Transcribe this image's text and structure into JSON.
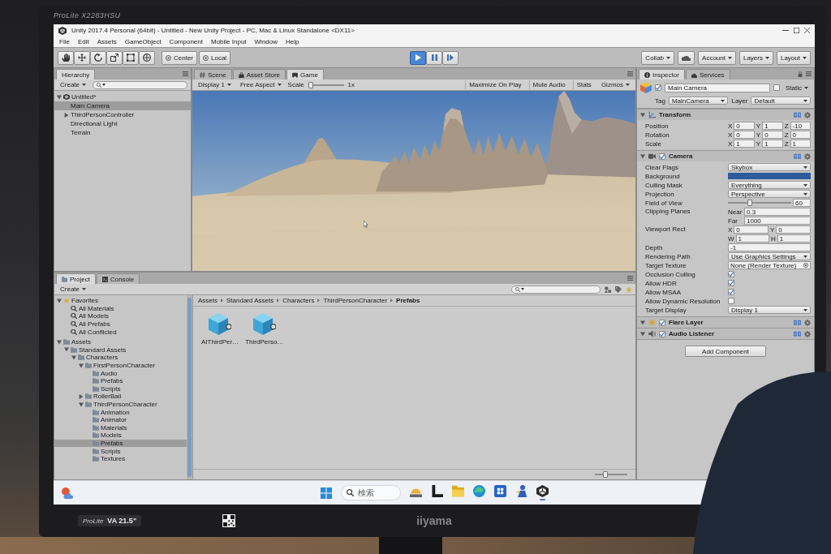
{
  "monitor": {
    "model": "ProLite X2283HSU",
    "brand": "iiyama",
    "sticker": {
      "series": "ProLite",
      "size": "VA 21.5\""
    }
  },
  "title_bar": {
    "title": "Unity 2017.4 Personal (64bit) - Untitled - New Unity Project - PC, Mac & Linux Standalone <DX11>"
  },
  "menu": [
    "File",
    "Edit",
    "Assets",
    "GameObject",
    "Component",
    "Mobile Input",
    "Window",
    "Help"
  ],
  "toolbar": {
    "pivot": "Center",
    "space": "Local",
    "playing": true,
    "collab": "Collab",
    "account": "Account",
    "layers": "Layers",
    "layout": "Layout"
  },
  "hierarchy": {
    "tabs": [
      {
        "label": "Hierarchy",
        "selected": true
      }
    ],
    "create": "Create",
    "items": [
      {
        "label": "Untitled*",
        "kind": "scene",
        "expanded": true,
        "selected": false,
        "children": [
          {
            "label": "Main Camera",
            "selected": true
          },
          {
            "label": "ThirdPersonController",
            "expanded": false,
            "selected": false
          },
          {
            "label": "Directional Light",
            "selected": false
          },
          {
            "label": "Terrain",
            "selected": false
          }
        ]
      }
    ]
  },
  "center": {
    "tabs": [
      {
        "label": "Scene",
        "kind": "scene",
        "selected": false
      },
      {
        "label": "Asset Store",
        "kind": "store",
        "selected": false
      },
      {
        "label": "Game",
        "kind": "game",
        "selected": true
      }
    ],
    "display": "Display 1",
    "aspect": "Free Aspect",
    "scale_label": "Scale",
    "scale": {
      "level": 0
    },
    "scale_value": "1x",
    "toggles": [
      "Maximize On Play",
      "Mute Audio",
      "Stats"
    ],
    "gizmos": "Gizmos"
  },
  "project": {
    "tabs": [
      {
        "label": "Project",
        "kind": "project",
        "selected": true
      },
      {
        "label": "Console",
        "kind": "console",
        "selected": false
      }
    ],
    "create": "Create",
    "tree": [
      {
        "label": "Favorites",
        "kind": "favorites",
        "expanded": true,
        "selected": false,
        "children": [
          {
            "label": "All Materials",
            "kind": "search",
            "selected": false
          },
          {
            "label": "All Models",
            "kind": "search",
            "selected": false
          },
          {
            "label": "All Prefabs",
            "kind": "search",
            "selected": false
          },
          {
            "label": "All Conflicted",
            "kind": "search",
            "selected": false
          }
        ]
      },
      {
        "label": "Assets",
        "kind": "folder",
        "expanded": true,
        "selected": false,
        "children": [
          {
            "label": "Standard Assets",
            "kind": "folder",
            "expanded": true,
            "selected": false,
            "children": [
              {
                "label": "Characters",
                "kind": "folder",
                "expanded": true,
                "selected": false,
                "children": [
                  {
                    "label": "FirstPersonCharacter",
                    "kind": "folder",
                    "expanded": true,
                    "selected": false,
                    "children": [
                      {
                        "label": "Audio",
                        "kind": "folder",
                        "selected": false
                      },
                      {
                        "label": "Prefabs",
                        "kind": "folder",
                        "selected": false
                      },
                      {
                        "label": "Scripts",
                        "kind": "folder",
                        "selected": false
                      }
                    ]
                  },
                  {
                    "label": "RollerBall",
                    "kind": "folder",
                    "expanded": false,
                    "selected": false
                  },
                  {
                    "label": "ThirdPersonCharacter",
                    "kind": "folder",
                    "expanded": true,
                    "selected": false,
                    "children": [
                      {
                        "label": "Animation",
                        "kind": "folder",
                        "selected": false
                      },
                      {
                        "label": "Animator",
                        "kind": "folder",
                        "selected": false
                      },
                      {
                        "label": "Materials",
                        "kind": "folder",
                        "selected": false
                      },
                      {
                        "label": "Models",
                        "kind": "folder",
                        "selected": false
                      },
                      {
                        "label": "Prefabs",
                        "kind": "folder",
                        "selected": true
                      },
                      {
                        "label": "Scripts",
                        "kind": "folder",
                        "selected": false
                      },
                      {
                        "label": "Textures",
                        "kind": "folder",
                        "selected": false
                      }
                    ]
                  }
                ]
              }
            ]
          }
        ]
      }
    ],
    "breadcrumb": [
      "Assets",
      "Standard Assets",
      "Characters",
      "ThirdPersonCharacter",
      "Prefabs"
    ],
    "assets": [
      {
        "name": "AIThirdPer…"
      },
      {
        "name": "ThirdPerso…"
      }
    ],
    "icon_size": {
      "level": 0.3
    }
  },
  "inspector": {
    "tabs": [
      {
        "label": "Inspector",
        "kind": "inspector",
        "selected": true
      },
      {
        "label": "Services",
        "kind": "services",
        "selected": false
      }
    ],
    "object": {
      "active": true,
      "name": "Main Camera",
      "static": false,
      "static_label": "Static",
      "tag_label": "Tag",
      "tag": "MainCamera",
      "layer_label": "Layer",
      "layer": "Default"
    },
    "components": [
      {
        "name": "Transform",
        "kind": "transform",
        "expanded": true,
        "rows": [
          {
            "kind": "vector",
            "label": "Position",
            "fields": [
              {
                "axis": "X",
                "value": "0"
              },
              {
                "axis": "Y",
                "value": "1"
              },
              {
                "axis": "Z",
                "value": "-10"
              }
            ]
          },
          {
            "kind": "vector",
            "label": "Rotation",
            "fields": [
              {
                "axis": "X",
                "value": "0"
              },
              {
                "axis": "Y",
                "value": "0"
              },
              {
                "axis": "Z",
                "value": "0"
              }
            ]
          },
          {
            "kind": "vector",
            "label": "Scale",
            "fields": [
              {
                "axis": "X",
                "value": "1"
              },
              {
                "axis": "Y",
                "value": "1"
              },
              {
                "axis": "Z",
                "value": "1"
              }
            ]
          }
        ]
      },
      {
        "name": "Camera",
        "kind": "camera",
        "enabled": true,
        "expanded": true,
        "rows": [
          {
            "kind": "dropdown",
            "label": "Clear Flags",
            "value": "Skybox"
          },
          {
            "kind": "color",
            "label": "Background",
            "color": "#2f5a9c"
          },
          {
            "kind": "dropdown",
            "label": "Culling Mask",
            "value": "Everything"
          },
          {
            "kind": "dropdown",
            "label": "Projection",
            "value": "Perspective"
          },
          {
            "kind": "slider",
            "label": "Field of View",
            "level": 0.33,
            "value": "60"
          },
          {
            "kind": "pairs",
            "label": "Clipping Planes",
            "fields": [
              {
                "axis": "Near",
                "value": "0.3"
              },
              {
                "axis": "Far",
                "value": "1000"
              }
            ]
          },
          {
            "kind": "grid",
            "label": "Viewport Rect",
            "fields": [
              {
                "axis": "X",
                "value": "0"
              },
              {
                "axis": "Y",
                "value": "0"
              },
              {
                "axis": "W",
                "value": "1"
              },
              {
                "axis": "H",
                "value": "1"
              }
            ]
          },
          {
            "kind": "number",
            "label": "Depth",
            "value": "-1"
          },
          {
            "kind": "dropdown",
            "label": "Rendering Path",
            "value": "Use Graphics Settings"
          },
          {
            "kind": "object",
            "label": "Target Texture",
            "value": "None (Render Texture)"
          },
          {
            "kind": "checkbox",
            "label": "Occlusion Culling",
            "checked": true
          },
          {
            "kind": "checkbox",
            "label": "Allow HDR",
            "checked": true
          },
          {
            "kind": "checkbox",
            "label": "Allow MSAA",
            "checked": true
          },
          {
            "kind": "checkbox",
            "label": "Allow Dynamic Resolution",
            "checked": false
          },
          {
            "kind": "dropdown",
            "label": "Target Display",
            "value": "Display 1"
          }
        ]
      },
      {
        "name": "Flare Layer",
        "kind": "flare",
        "enabled": true,
        "expanded": true
      },
      {
        "name": "Audio Listener",
        "kind": "audio",
        "enabled": true,
        "expanded": true
      }
    ],
    "add_component": "Add Component"
  },
  "taskbar": {
    "search": {
      "placeholder": "検索"
    },
    "apps": [
      {
        "kind": "widgets",
        "running": false
      },
      {
        "kind": "bracket",
        "running": false
      },
      {
        "kind": "folder",
        "running": false
      },
      {
        "kind": "browser",
        "running": false
      },
      {
        "kind": "store",
        "running": false
      },
      {
        "kind": "figure",
        "running": false
      },
      {
        "kind": "unity",
        "running": true
      }
    ]
  }
}
